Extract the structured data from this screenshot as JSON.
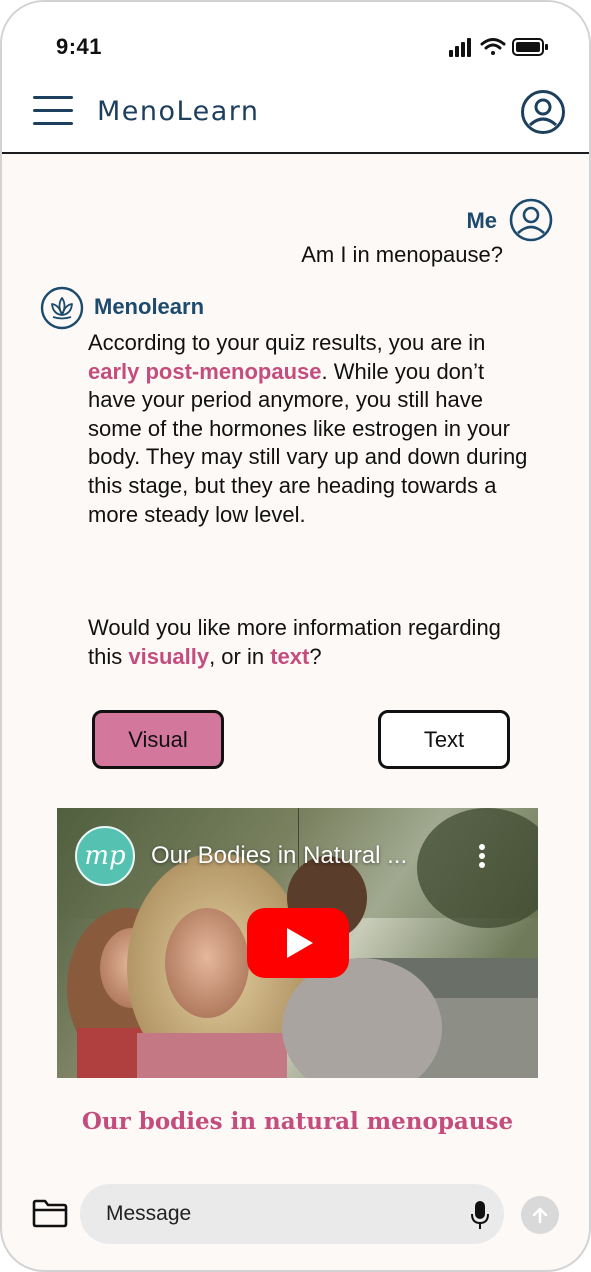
{
  "status_bar": {
    "time": "9:41"
  },
  "header": {
    "app_title": "MenoLearn"
  },
  "chat": {
    "user": {
      "name": "Me",
      "message": "Am I in menopause?"
    },
    "bot": {
      "name": "Menolearn",
      "message_parts": [
        "According to your quiz results, you are in ",
        "early post-menopause",
        ". While you don’t have your period anymore, you still have some of the hormones like estrogen in your body. They may still vary up and down during this stage, but they are heading towards a more steady low level."
      ],
      "question_parts": [
        "Would you like more information regarding this ",
        "visually",
        ", or in ",
        "text",
        "?"
      ]
    },
    "choices": {
      "visual": "Visual",
      "text": "Text"
    },
    "video": {
      "channel_logo_text": "mp",
      "title": "Our Bodies in Natural ...",
      "caption": "Our bodies in natural menopause"
    }
  },
  "composer": {
    "placeholder": "Message"
  },
  "colors": {
    "navy": "#1d3f5e",
    "accent_pink": "#c44d7e",
    "visual_button": "#d4779d",
    "background": "#fdf9f6",
    "youtube_red": "#ff0000",
    "logo_teal": "#55c2b1"
  },
  "icons": [
    "menu-icon",
    "profile-icon",
    "user-avatar-icon",
    "lotus-icon",
    "play-icon",
    "more-vertical-icon",
    "folder-icon",
    "mic-icon",
    "send-arrow-icon",
    "signal-icon",
    "wifi-icon",
    "battery-icon"
  ]
}
